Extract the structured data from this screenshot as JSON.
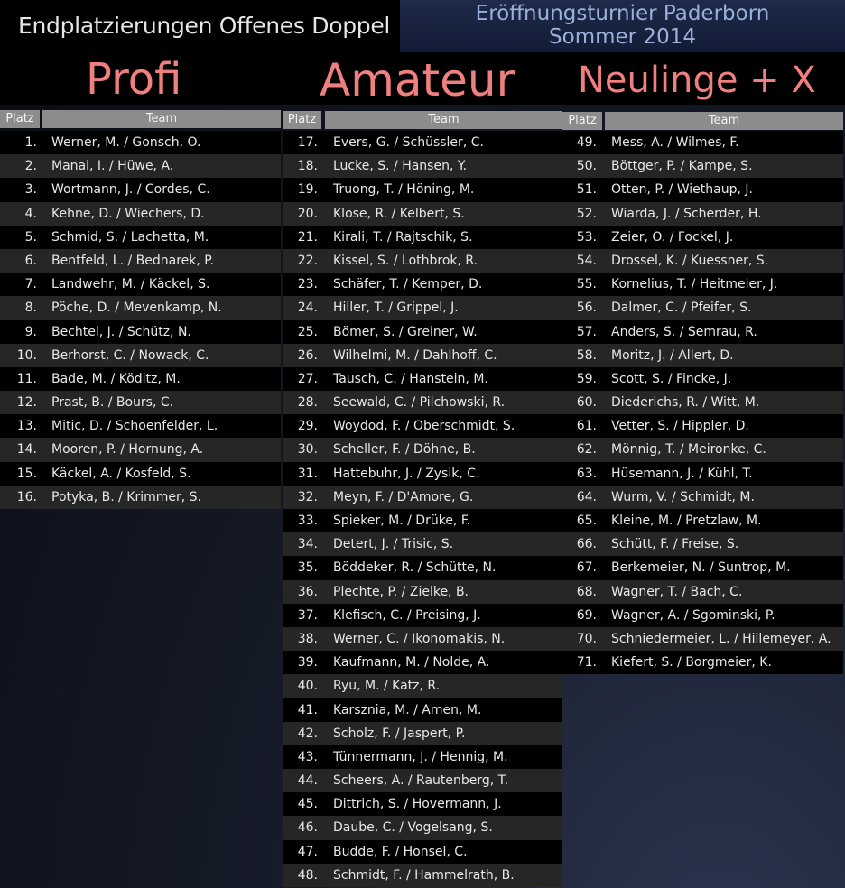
{
  "header": {
    "title": "Endplatzierungen Offenes Doppel",
    "event_line1": "Eröffnungsturnier Paderborn",
    "event_line2": "Sommer 2014"
  },
  "columns": {
    "platz": "Platz",
    "team": "Team"
  },
  "categories": [
    {
      "label": "Profi",
      "rows": [
        {
          "place": "1.",
          "team": "Werner, M. / Gonsch, O."
        },
        {
          "place": "2.",
          "team": "Manai, I. / Hüwe, A."
        },
        {
          "place": "3.",
          "team": "Wortmann, J. / Cordes, C."
        },
        {
          "place": "4.",
          "team": "Kehne, D. / Wiechers, D."
        },
        {
          "place": "5.",
          "team": "Schmid, S. / Lachetta, M."
        },
        {
          "place": "6.",
          "team": "Bentfeld, L. / Bednarek, P."
        },
        {
          "place": "7.",
          "team": "Landwehr, M. / Käckel, S."
        },
        {
          "place": "8.",
          "team": "Pöche, D. / Mevenkamp, N."
        },
        {
          "place": "9.",
          "team": "Bechtel, J. / Schütz, N."
        },
        {
          "place": "10.",
          "team": "Berhorst, C. / Nowack, C."
        },
        {
          "place": "11.",
          "team": "Bade, M. / Köditz, M."
        },
        {
          "place": "12.",
          "team": "Prast, B. / Bours, C."
        },
        {
          "place": "13.",
          "team": "Mitic, D. / Schoenfelder, L."
        },
        {
          "place": "14.",
          "team": "Mooren, P. / Hornung, A."
        },
        {
          "place": "15.",
          "team": "Käckel, A. / Kosfeld, S."
        },
        {
          "place": "16.",
          "team": "Potyka, B. / Krimmer, S."
        }
      ]
    },
    {
      "label": "Amateur",
      "rows": [
        {
          "place": "17.",
          "team": "Evers, G. / Schüssler, C."
        },
        {
          "place": "18.",
          "team": "Lucke, S. / Hansen, Y."
        },
        {
          "place": "19.",
          "team": "Truong, T. / Höning, M."
        },
        {
          "place": "20.",
          "team": "Klose, R. / Kelbert, S."
        },
        {
          "place": "21.",
          "team": "Kirali, T. / Rajtschik, S."
        },
        {
          "place": "22.",
          "team": "Kissel, S. / Lothbrok, R."
        },
        {
          "place": "23.",
          "team": "Schäfer, T. / Kemper, D."
        },
        {
          "place": "24.",
          "team": "Hiller, T. / Grippel, J."
        },
        {
          "place": "25.",
          "team": "Bömer, S. / Greiner, W."
        },
        {
          "place": "26.",
          "team": "Wilhelmi, M. / Dahlhoff, C."
        },
        {
          "place": "27.",
          "team": "Tausch, C. / Hanstein, M."
        },
        {
          "place": "28.",
          "team": "Seewald, C. / Pilchowski, R."
        },
        {
          "place": "29.",
          "team": "Woydod, F. / Oberschmidt, S."
        },
        {
          "place": "30.",
          "team": "Scheller, F. / Döhne, B."
        },
        {
          "place": "31.",
          "team": "Hattebuhr, J. / Zysik, C."
        },
        {
          "place": "32.",
          "team": "Meyn, F. / D'Amore, G."
        },
        {
          "place": "33.",
          "team": "Spieker, M. / Drüke, F."
        },
        {
          "place": "34.",
          "team": "Detert, J. / Trisic, S."
        },
        {
          "place": "35.",
          "team": "Böddeker, R. / Schütte, N."
        },
        {
          "place": "36.",
          "team": "Plechte, P. / Zielke, B."
        },
        {
          "place": "37.",
          "team": "Klefisch, C. / Preising, J."
        },
        {
          "place": "38.",
          "team": "Werner, C. / Ikonomakis, N."
        },
        {
          "place": "39.",
          "team": "Kaufmann, M. / Nolde, A."
        },
        {
          "place": "40.",
          "team": "Ryu, M. / Katz, R."
        },
        {
          "place": "41.",
          "team": "Karsznia, M. / Amen, M."
        },
        {
          "place": "42.",
          "team": "Scholz, F. / Jaspert, P."
        },
        {
          "place": "43.",
          "team": "Tünnermann, J. / Hennig, M."
        },
        {
          "place": "44.",
          "team": "Scheers, A. / Rautenberg, T."
        },
        {
          "place": "45.",
          "team": "Dittrich, S. / Hovermann, J."
        },
        {
          "place": "46.",
          "team": "Daube, C. / Vogelsang, S."
        },
        {
          "place": "47.",
          "team": "Budde, F. / Honsel, C."
        },
        {
          "place": "48.",
          "team": "Schmidt, F. / Hammelrath, B."
        }
      ]
    },
    {
      "label": "Neulinge + X",
      "rows": [
        {
          "place": "49.",
          "team": "Mess, A. / Wilmes, F."
        },
        {
          "place": "50.",
          "team": "Böttger, P. / Kampe, S."
        },
        {
          "place": "51.",
          "team": "Otten, P. / Wiethaup, J."
        },
        {
          "place": "52.",
          "team": "Wiarda, J. / Scherder, H."
        },
        {
          "place": "53.",
          "team": "Zeier, O. / Fockel, J."
        },
        {
          "place": "54.",
          "team": "Drossel, K. / Kuessner, S."
        },
        {
          "place": "55.",
          "team": "Kornelius, T. / Heitmeier, J."
        },
        {
          "place": "56.",
          "team": "Dalmer, C. / Pfeifer, S."
        },
        {
          "place": "57.",
          "team": "Anders, S. / Semrau, R."
        },
        {
          "place": "58.",
          "team": "Moritz, J. / Allert, D."
        },
        {
          "place": "59.",
          "team": "Scott, S. / Fincke, J."
        },
        {
          "place": "60.",
          "team": "Diederichs, R. / Witt, M."
        },
        {
          "place": "61.",
          "team": "Vetter, S. / Hippler, D."
        },
        {
          "place": "62.",
          "team": "Mönnig, T. / Meironke, C."
        },
        {
          "place": "63.",
          "team": "Hüsemann, J. / Kühl, T."
        },
        {
          "place": "64.",
          "team": "Wurm, V. / Schmidt, M."
        },
        {
          "place": "65.",
          "team": "Kleine, M. / Pretzlaw, M."
        },
        {
          "place": "66.",
          "team": "Schütt, F. / Freise, S."
        },
        {
          "place": "67.",
          "team": "Berkemeier, N. / Suntrop, M."
        },
        {
          "place": "68.",
          "team": "Wagner, T. / Bach, C."
        },
        {
          "place": "69.",
          "team": "Wagner, A. / Sgominski, P."
        },
        {
          "place": "70.",
          "team": "Schniedermeier, L. / Hillemeyer, A."
        },
        {
          "place": "71.",
          "team": "Kiefert, S. / Borgmeier, K."
        }
      ]
    }
  ],
  "colors": {
    "category_label": "#f07f7f",
    "header_cell": "#8c8c8c",
    "row_dark": "#000000",
    "row_light": "#262626",
    "event_text": "#9bb0d8"
  }
}
